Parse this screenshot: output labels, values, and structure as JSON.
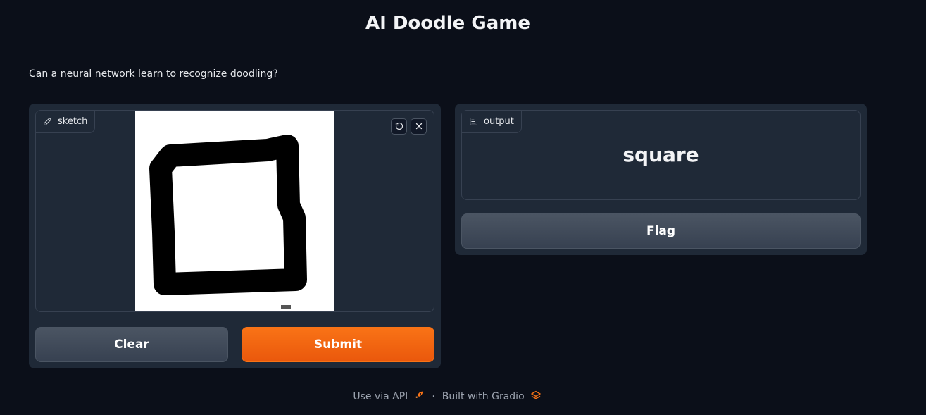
{
  "app": {
    "title": "AI Doodle Game",
    "description": "Can a neural network learn to recognize doodling?"
  },
  "input": {
    "label": "sketch",
    "label_icon": "pencil-icon",
    "tools": [
      "undo-icon",
      "close-icon"
    ],
    "canvas_background": "#ffffff",
    "stroke_color": "#000000"
  },
  "buttons": {
    "clear": "Clear",
    "submit": "Submit",
    "flag": "Flag"
  },
  "output": {
    "label": "output",
    "label_icon": "chart-icon",
    "value": "square"
  },
  "footer": {
    "api_text": "Use via API",
    "api_icon": "rocket-icon",
    "separator": "·",
    "built_text": "Built with Gradio",
    "built_icon": "gradio-logo-icon"
  },
  "colors": {
    "background": "#0b0f19",
    "panel": "#1f2937",
    "border": "#374151",
    "primary": "#f97316",
    "secondary": "#4b5563"
  }
}
